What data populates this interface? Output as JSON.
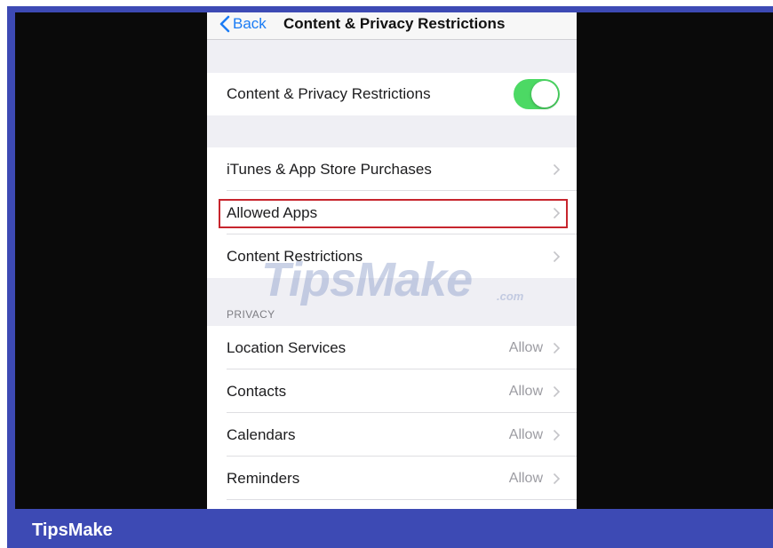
{
  "header": {
    "back_label": "Back",
    "title": "Content & Privacy Restrictions"
  },
  "toggle_row": {
    "label": "Content & Privacy Restrictions",
    "enabled": true,
    "toggle_color": "#4cd964"
  },
  "store_group": [
    {
      "label": "iTunes & App Store Purchases"
    },
    {
      "label": "Allowed Apps",
      "highlighted": true
    },
    {
      "label": "Content Restrictions"
    }
  ],
  "privacy": {
    "header": "PRIVACY",
    "items": [
      {
        "label": "Location Services",
        "value": "Allow"
      },
      {
        "label": "Contacts",
        "value": "Allow"
      },
      {
        "label": "Calendars",
        "value": "Allow"
      },
      {
        "label": "Reminders",
        "value": "Allow"
      }
    ]
  },
  "watermark": {
    "text": "TipsMake",
    "suffix": ".com"
  },
  "footer": {
    "brand": "TipsMake"
  },
  "colors": {
    "accent": "#1a7cf5",
    "highlight": "#c7252d",
    "frame": "#3d4ab4"
  }
}
